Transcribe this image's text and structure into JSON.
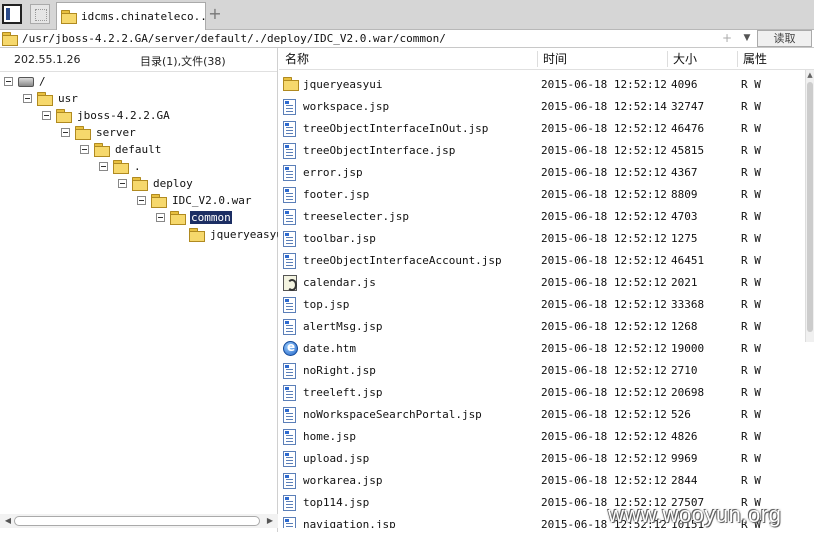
{
  "tab": {
    "label": "idcms.chinateleco..."
  },
  "address": {
    "path": "/usr/jboss-4.2.2.GA/server/default/./deploy/IDC_V2.0.war/common/",
    "read_label": "读取"
  },
  "left": {
    "ip": "202.55.1.26",
    "counts": "目录(1),文件(38)",
    "tree": [
      {
        "label": "/",
        "icon": "drive-icon",
        "depth": 0,
        "toggle": true
      },
      {
        "label": "usr",
        "icon": "folder-icon",
        "depth": 1,
        "toggle": true
      },
      {
        "label": "jboss-4.2.2.GA",
        "icon": "folder-icon",
        "depth": 2,
        "toggle": true
      },
      {
        "label": "server",
        "icon": "folder-icon",
        "depth": 3,
        "toggle": true
      },
      {
        "label": "default",
        "icon": "folder-icon",
        "depth": 4,
        "toggle": true
      },
      {
        "label": ".",
        "icon": "folder-icon",
        "depth": 5,
        "toggle": true
      },
      {
        "label": "deploy",
        "icon": "folder-icon",
        "depth": 6,
        "toggle": true
      },
      {
        "label": "IDC_V2.0.war",
        "icon": "folder-icon",
        "depth": 7,
        "toggle": true
      },
      {
        "label": "common",
        "icon": "folder-icon",
        "depth": 8,
        "toggle": true,
        "selected": true
      },
      {
        "label": "jqueryeasyui",
        "icon": "folder-icon",
        "depth": 9,
        "toggle": false
      }
    ]
  },
  "columns": {
    "name": "名称",
    "time": "时间",
    "size": "大小",
    "attr": "属性"
  },
  "files": [
    {
      "name": "jqueryeasyui",
      "time": "2015-06-18 12:52:12",
      "size": "4096",
      "attr": "R W",
      "icon": "folder-icon"
    },
    {
      "name": "workspace.jsp",
      "time": "2015-06-18 12:52:14",
      "size": "32747",
      "attr": "R W",
      "icon": "file-icon"
    },
    {
      "name": "treeObjectInterfaceInOut.jsp",
      "time": "2015-06-18 12:52:12",
      "size": "46476",
      "attr": "R W",
      "icon": "file-icon"
    },
    {
      "name": "treeObjectInterface.jsp",
      "time": "2015-06-18 12:52:12",
      "size": "45815",
      "attr": "R W",
      "icon": "file-icon"
    },
    {
      "name": "error.jsp",
      "time": "2015-06-18 12:52:12",
      "size": "4367",
      "attr": "R W",
      "icon": "file-icon"
    },
    {
      "name": "footer.jsp",
      "time": "2015-06-18 12:52:12",
      "size": "8809",
      "attr": "R W",
      "icon": "file-icon"
    },
    {
      "name": "treeselecter.jsp",
      "time": "2015-06-18 12:52:12",
      "size": "4703",
      "attr": "R W",
      "icon": "file-icon"
    },
    {
      "name": "toolbar.jsp",
      "time": "2015-06-18 12:52:12",
      "size": "1275",
      "attr": "R W",
      "icon": "file-icon"
    },
    {
      "name": "treeObjectInterfaceAccount.jsp",
      "time": "2015-06-18 12:52:12",
      "size": "46451",
      "attr": "R W",
      "icon": "file-icon"
    },
    {
      "name": "calendar.js",
      "time": "2015-06-18 12:52:12",
      "size": "2021",
      "attr": "R W",
      "icon": "js-file-icon"
    },
    {
      "name": "top.jsp",
      "time": "2015-06-18 12:52:12",
      "size": "33368",
      "attr": "R W",
      "icon": "file-icon"
    },
    {
      "name": "alertMsg.jsp",
      "time": "2015-06-18 12:52:12",
      "size": "1268",
      "attr": "R W",
      "icon": "file-icon"
    },
    {
      "name": "date.htm",
      "time": "2015-06-18 12:52:12",
      "size": "19000",
      "attr": "R W",
      "icon": "html-file-icon"
    },
    {
      "name": "noRight.jsp",
      "time": "2015-06-18 12:52:12",
      "size": "2710",
      "attr": "R W",
      "icon": "file-icon"
    },
    {
      "name": "treeleft.jsp",
      "time": "2015-06-18 12:52:12",
      "size": "20698",
      "attr": "R W",
      "icon": "file-icon"
    },
    {
      "name": "noWorkspaceSearchPortal.jsp",
      "time": "2015-06-18 12:52:12",
      "size": "526",
      "attr": "R W",
      "icon": "file-icon"
    },
    {
      "name": "home.jsp",
      "time": "2015-06-18 12:52:12",
      "size": "4826",
      "attr": "R W",
      "icon": "file-icon"
    },
    {
      "name": "upload.jsp",
      "time": "2015-06-18 12:52:12",
      "size": "9969",
      "attr": "R W",
      "icon": "file-icon"
    },
    {
      "name": "workarea.jsp",
      "time": "2015-06-18 12:52:12",
      "size": "2844",
      "attr": "R W",
      "icon": "file-icon"
    },
    {
      "name": "top114.jsp",
      "time": "2015-06-18 12:52:12",
      "size": "27507",
      "attr": "R W",
      "icon": "file-icon"
    },
    {
      "name": "navigation.jsp",
      "time": "2015-06-18 12:52:12",
      "size": "10151",
      "attr": "R W",
      "icon": "file-icon"
    }
  ],
  "watermark": "www.wooyun.org",
  "colors": {
    "selection": "#1c2e63",
    "folder": "#f6d86c"
  }
}
